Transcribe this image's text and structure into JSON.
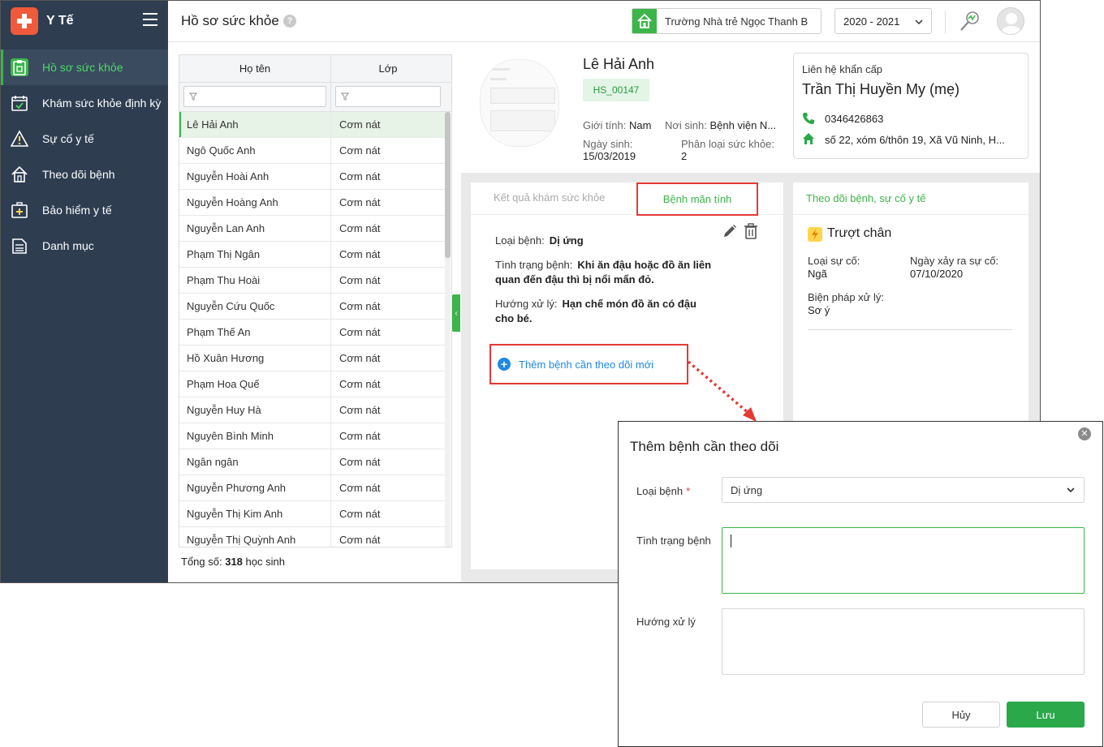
{
  "app": {
    "name": "Y Tế",
    "brand_color": "#ef5a3a",
    "accent": "#3cb54a",
    "sidebar_bg": "#2e3d50"
  },
  "sidebar": {
    "items": [
      {
        "label": "Hồ sơ sức khỏe",
        "icon": "clipboard-icon",
        "active": true
      },
      {
        "label": "Khám sức khỏe định kỳ",
        "icon": "calendar-check-icon",
        "active": false
      },
      {
        "label": "Sự cố y tế",
        "icon": "warning-icon",
        "active": false
      },
      {
        "label": "Theo dõi bệnh",
        "icon": "house-icon",
        "active": false
      },
      {
        "label": "Bảo hiểm y tế",
        "icon": "medical-kit-icon",
        "active": false
      },
      {
        "label": "Danh mục",
        "icon": "list-icon",
        "active": false
      }
    ]
  },
  "header": {
    "title": "Hồ sơ sức khỏe",
    "help": "?",
    "school": "Trường Nhà trẻ Ngọc Thanh B",
    "year": "2020 - 2021"
  },
  "students": {
    "columns": [
      "Họ tên",
      "Lớp"
    ],
    "rows": [
      {
        "name": "Lê Hải Anh",
        "class": "Cơm nát"
      },
      {
        "name": "Ngô Quốc Anh",
        "class": "Cơm nát"
      },
      {
        "name": "Nguyễn Hoài Anh",
        "class": "Cơm nát"
      },
      {
        "name": "Nguyễn Hoàng Anh",
        "class": "Cơm nát"
      },
      {
        "name": "Nguyễn Lan Anh",
        "class": "Cơm nát"
      },
      {
        "name": "Phạm Thị Ngân",
        "class": "Cơm nát"
      },
      {
        "name": "Phạm Thu Hoài",
        "class": "Cơm nát"
      },
      {
        "name": "Nguyễn Cứu Quốc",
        "class": "Cơm nát"
      },
      {
        "name": "Phạm Thế An",
        "class": "Cơm nát"
      },
      {
        "name": "Hồ Xuân Hương",
        "class": "Cơm nát"
      },
      {
        "name": "Phạm Hoa Quế",
        "class": "Cơm nát"
      },
      {
        "name": "Nguyễn Huy Hà",
        "class": "Cơm nát"
      },
      {
        "name": "Nguyên Bình Minh",
        "class": "Cơm nát"
      },
      {
        "name": "Ngân ngân",
        "class": "Cơm nát"
      },
      {
        "name": "Nguyễn Phương Anh",
        "class": "Cơm nát"
      },
      {
        "name": "Nguyễn Thị Kim Anh",
        "class": "Cơm nát"
      },
      {
        "name": "Nguyễn Thị Quỳnh Anh",
        "class": "Cơm nát"
      }
    ],
    "total_label": "Tổng số:",
    "total_count": "318",
    "total_unit": "học sinh"
  },
  "profile": {
    "name": "Lê Hải Anh",
    "code": "HS_00147",
    "gender_label": "Giới tính:",
    "gender": "Nam",
    "birthplace_label": "Nơi sinh:",
    "birthplace": "Bệnh viện N...",
    "dob_label": "Ngày sinh:",
    "dob": "15/03/2019",
    "health_class_label": "Phân loại sức khỏe:",
    "health_class": "2"
  },
  "emergency": {
    "title": "Liên hệ khẩn cấp",
    "name": "Trần Thị Huyền My (mẹ)",
    "phone": "0346426863",
    "address": "số 22, xóm 6/thôn 19, Xã Vũ Ninh, H..."
  },
  "tabs": {
    "exam_results": "Kết quả khám sức khỏe",
    "chronic": "Bệnh mãn tính"
  },
  "chronic": {
    "type_label": "Loại bệnh:",
    "type": "Dị ứng",
    "status_label": "Tình trạng bệnh:",
    "status_line1": "Khi ăn đậu hoặc đồ ăn liên",
    "status_line2": "quan đến đậu thì bị nổi mẩn đỏ.",
    "treatment_label": "Hướng xử lý:",
    "treatment_line1": "Hạn chế món đồ ăn có đậu",
    "treatment_line2": "cho bé.",
    "add_new": "Thêm bệnh cần theo dõi mới"
  },
  "incidents": {
    "title": "Theo dõi bệnh, sự cố y tế",
    "name": "Trượt chân",
    "type_label": "Loại sự cố:",
    "type": "Ngã",
    "date_label": "Ngày xảy ra sự cố:",
    "date": "07/10/2020",
    "measure_label": "Biện pháp xử lý:",
    "measure": "Sơ ý"
  },
  "modal": {
    "title": "Thêm bệnh cần theo dõi",
    "type_label": "Loại bệnh",
    "required_mark": "*",
    "type_value": "Dị ứng",
    "status_label": "Tình trạng bệnh",
    "status_value": "",
    "treatment_label": "Hướng xử lý",
    "treatment_value": "",
    "cancel": "Hủy",
    "save": "Lưu"
  }
}
